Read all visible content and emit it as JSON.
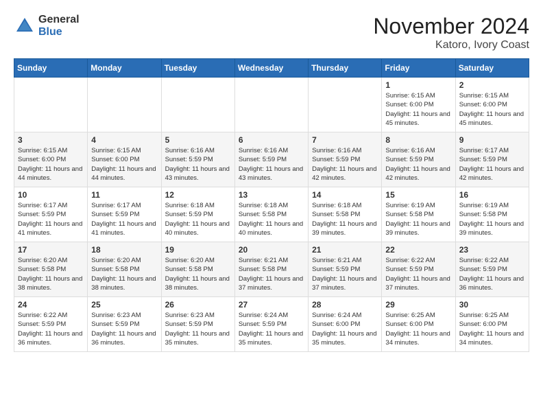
{
  "logo": {
    "general": "General",
    "blue": "Blue"
  },
  "title": "November 2024",
  "location": "Katoro, Ivory Coast",
  "headers": [
    "Sunday",
    "Monday",
    "Tuesday",
    "Wednesday",
    "Thursday",
    "Friday",
    "Saturday"
  ],
  "weeks": [
    [
      {
        "day": "",
        "info": ""
      },
      {
        "day": "",
        "info": ""
      },
      {
        "day": "",
        "info": ""
      },
      {
        "day": "",
        "info": ""
      },
      {
        "day": "",
        "info": ""
      },
      {
        "day": "1",
        "info": "Sunrise: 6:15 AM\nSunset: 6:00 PM\nDaylight: 11 hours and 45 minutes."
      },
      {
        "day": "2",
        "info": "Sunrise: 6:15 AM\nSunset: 6:00 PM\nDaylight: 11 hours and 45 minutes."
      }
    ],
    [
      {
        "day": "3",
        "info": "Sunrise: 6:15 AM\nSunset: 6:00 PM\nDaylight: 11 hours and 44 minutes."
      },
      {
        "day": "4",
        "info": "Sunrise: 6:15 AM\nSunset: 6:00 PM\nDaylight: 11 hours and 44 minutes."
      },
      {
        "day": "5",
        "info": "Sunrise: 6:16 AM\nSunset: 5:59 PM\nDaylight: 11 hours and 43 minutes."
      },
      {
        "day": "6",
        "info": "Sunrise: 6:16 AM\nSunset: 5:59 PM\nDaylight: 11 hours and 43 minutes."
      },
      {
        "day": "7",
        "info": "Sunrise: 6:16 AM\nSunset: 5:59 PM\nDaylight: 11 hours and 42 minutes."
      },
      {
        "day": "8",
        "info": "Sunrise: 6:16 AM\nSunset: 5:59 PM\nDaylight: 11 hours and 42 minutes."
      },
      {
        "day": "9",
        "info": "Sunrise: 6:17 AM\nSunset: 5:59 PM\nDaylight: 11 hours and 42 minutes."
      }
    ],
    [
      {
        "day": "10",
        "info": "Sunrise: 6:17 AM\nSunset: 5:59 PM\nDaylight: 11 hours and 41 minutes."
      },
      {
        "day": "11",
        "info": "Sunrise: 6:17 AM\nSunset: 5:59 PM\nDaylight: 11 hours and 41 minutes."
      },
      {
        "day": "12",
        "info": "Sunrise: 6:18 AM\nSunset: 5:59 PM\nDaylight: 11 hours and 40 minutes."
      },
      {
        "day": "13",
        "info": "Sunrise: 6:18 AM\nSunset: 5:58 PM\nDaylight: 11 hours and 40 minutes."
      },
      {
        "day": "14",
        "info": "Sunrise: 6:18 AM\nSunset: 5:58 PM\nDaylight: 11 hours and 39 minutes."
      },
      {
        "day": "15",
        "info": "Sunrise: 6:19 AM\nSunset: 5:58 PM\nDaylight: 11 hours and 39 minutes."
      },
      {
        "day": "16",
        "info": "Sunrise: 6:19 AM\nSunset: 5:58 PM\nDaylight: 11 hours and 39 minutes."
      }
    ],
    [
      {
        "day": "17",
        "info": "Sunrise: 6:20 AM\nSunset: 5:58 PM\nDaylight: 11 hours and 38 minutes."
      },
      {
        "day": "18",
        "info": "Sunrise: 6:20 AM\nSunset: 5:58 PM\nDaylight: 11 hours and 38 minutes."
      },
      {
        "day": "19",
        "info": "Sunrise: 6:20 AM\nSunset: 5:58 PM\nDaylight: 11 hours and 38 minutes."
      },
      {
        "day": "20",
        "info": "Sunrise: 6:21 AM\nSunset: 5:58 PM\nDaylight: 11 hours and 37 minutes."
      },
      {
        "day": "21",
        "info": "Sunrise: 6:21 AM\nSunset: 5:59 PM\nDaylight: 11 hours and 37 minutes."
      },
      {
        "day": "22",
        "info": "Sunrise: 6:22 AM\nSunset: 5:59 PM\nDaylight: 11 hours and 37 minutes."
      },
      {
        "day": "23",
        "info": "Sunrise: 6:22 AM\nSunset: 5:59 PM\nDaylight: 11 hours and 36 minutes."
      }
    ],
    [
      {
        "day": "24",
        "info": "Sunrise: 6:22 AM\nSunset: 5:59 PM\nDaylight: 11 hours and 36 minutes."
      },
      {
        "day": "25",
        "info": "Sunrise: 6:23 AM\nSunset: 5:59 PM\nDaylight: 11 hours and 36 minutes."
      },
      {
        "day": "26",
        "info": "Sunrise: 6:23 AM\nSunset: 5:59 PM\nDaylight: 11 hours and 35 minutes."
      },
      {
        "day": "27",
        "info": "Sunrise: 6:24 AM\nSunset: 5:59 PM\nDaylight: 11 hours and 35 minutes."
      },
      {
        "day": "28",
        "info": "Sunrise: 6:24 AM\nSunset: 6:00 PM\nDaylight: 11 hours and 35 minutes."
      },
      {
        "day": "29",
        "info": "Sunrise: 6:25 AM\nSunset: 6:00 PM\nDaylight: 11 hours and 34 minutes."
      },
      {
        "day": "30",
        "info": "Sunrise: 6:25 AM\nSunset: 6:00 PM\nDaylight: 11 hours and 34 minutes."
      }
    ]
  ]
}
